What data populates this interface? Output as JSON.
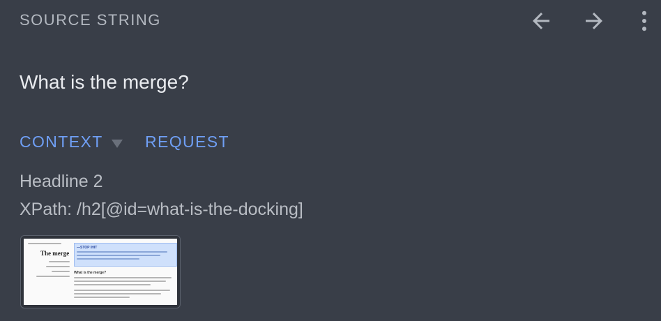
{
  "header": {
    "title": "SOURCE STRING",
    "icons": [
      "arrow-back-icon",
      "arrow-forward-icon",
      "more-vert-icon"
    ]
  },
  "source": {
    "text": "What is the merge?"
  },
  "tabs": [
    {
      "label": "CONTEXT",
      "active": true
    },
    {
      "label": "REQUEST",
      "active": false
    }
  ],
  "context": {
    "type": "Headline 2",
    "xpath": "XPath: /h2[@id=what-is-the-docking]"
  },
  "screenshot": {
    "nav_title": "The merge",
    "highlight_title": "—ЅТОР ІНІТ",
    "body_heading": "What is the merge?"
  },
  "colors": {
    "background": "#393e48",
    "accent": "#6f9ff5",
    "icon": "#b3b8c0"
  }
}
